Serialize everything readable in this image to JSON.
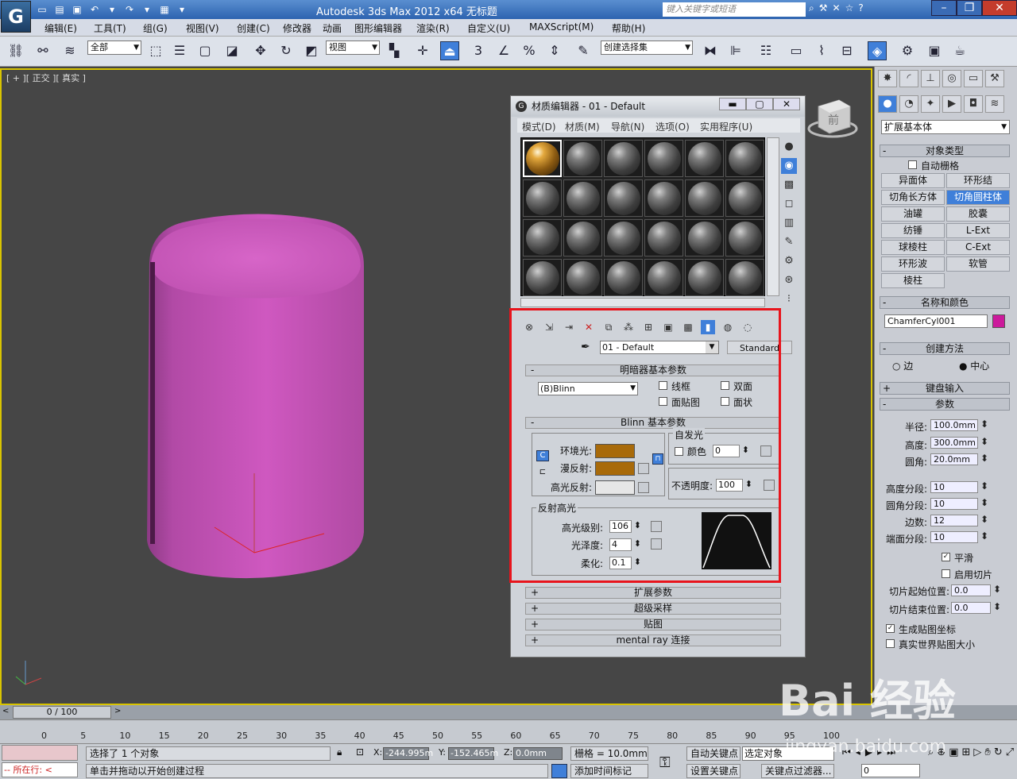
{
  "titlebar": {
    "app_title": "Autodesk 3ds Max  2012 x64      无标题",
    "search_placeholder": "键入关键字或短语",
    "logo": "G"
  },
  "menu": [
    "编辑(E)",
    "工具(T)",
    "组(G)",
    "视图(V)",
    "创建(C)",
    "修改器",
    "动画",
    "图形编辑器",
    "渲染(R)",
    "自定义(U)",
    "MAXScript(M)",
    "帮助(H)"
  ],
  "toolbar": {
    "select_filter": "全部",
    "ref_coord": "视图",
    "snap_label": "3",
    "named_sel": "创建选择集"
  },
  "viewport": {
    "label": "[ + ][ 正交 ][ 真实 ]",
    "object_color": "#cc55bb",
    "view_cube_label": "前"
  },
  "material_editor": {
    "title": "材质编辑器 - 01 - Default",
    "menu": [
      "模式(D)",
      "材质(M)",
      "导航(N)",
      "选项(O)",
      "实用程序(U)"
    ],
    "material_name": "01 - Default",
    "material_type": "Standard",
    "shader_rollout": "明暗器基本参数",
    "shader": "(B)Blinn",
    "shader_opts": [
      "线框",
      "双面",
      "面贴图",
      "面状"
    ],
    "blinn_rollout": "Blinn 基本参数",
    "self_illum": "自发光",
    "color_label": "颜色",
    "self_illum_value": "0",
    "ambient": "环境光:",
    "diffuse": "漫反射:",
    "specular": "高光反射:",
    "ambient_color": "#a86a0a",
    "diffuse_color": "#a86a0a",
    "specular_color": "#e6e6e6",
    "opacity_label": "不透明度:",
    "opacity": "100",
    "spec_highlights": "反射高光",
    "spec_level_label": "高光级别:",
    "spec_level": "106",
    "gloss_label": "光泽度:",
    "gloss": "4",
    "soften_label": "柔化:",
    "soften": "0.1",
    "collapsed": [
      "扩展参数",
      "超级采样",
      "贴图",
      "mental ray 连接"
    ]
  },
  "command_panel": {
    "category": "扩展基本体",
    "object_type": "对象类型",
    "autogrid": "自动栅格",
    "objects": [
      "异面体",
      "环形结",
      "切角长方体",
      "切角圆柱体",
      "油罐",
      "胶囊",
      "纺锤",
      "L-Ext",
      "球棱柱",
      "C-Ext",
      "环形波",
      "软管",
      "棱柱"
    ],
    "name_color": "名称和颜色",
    "object_name": "ChamferCyl001",
    "object_color": "#cc1a9c",
    "creation_method": "创建方法",
    "edge": "边",
    "center": "中心",
    "keyboard_entry": "键盘输入",
    "params": "参数",
    "params_list": [
      {
        "label": "半径:",
        "value": "100.0mm"
      },
      {
        "label": "高度:",
        "value": "300.0mm"
      },
      {
        "label": "圆角:",
        "value": "20.0mm"
      },
      {
        "label": "高度分段:",
        "value": "10"
      },
      {
        "label": "圆角分段:",
        "value": "10"
      },
      {
        "label": "边数:",
        "value": "12"
      },
      {
        "label": "端面分段:",
        "value": "10"
      }
    ],
    "smooth": "平滑",
    "slice_on": "启用切片",
    "slice_from": "切片起始位置:",
    "slice_from_v": "0.0",
    "slice_to": "切片结束位置:",
    "slice_to_v": "0.0",
    "gen_map": "生成贴图坐标",
    "real_world": "真实世界贴图大小"
  },
  "timeline": {
    "frame": "0 / 100",
    "ticks": [
      "0",
      "5",
      "10",
      "15",
      "20",
      "25",
      "30",
      "35",
      "40",
      "45",
      "50",
      "55",
      "60",
      "65",
      "70",
      "75",
      "80",
      "85",
      "90",
      "95",
      "100"
    ]
  },
  "status": {
    "selected": "选择了 1 个对象",
    "prompt": "单击并拖动以开始创建过程",
    "maxscript": "所在行:",
    "x": "-244.995m",
    "y": "-152.465m",
    "z": "0.0mm",
    "grid": "栅格 = 10.0mm",
    "autokey": "自动关键点",
    "setkey": "设置关键点",
    "sel_obj": "选定对象",
    "key_filter": "关键点过滤器...",
    "add_time_tag": "添加时间标记",
    "frame_field": "0"
  },
  "watermark": {
    "text": "Bai 经验",
    "url": "jingyan.baidu.com"
  }
}
